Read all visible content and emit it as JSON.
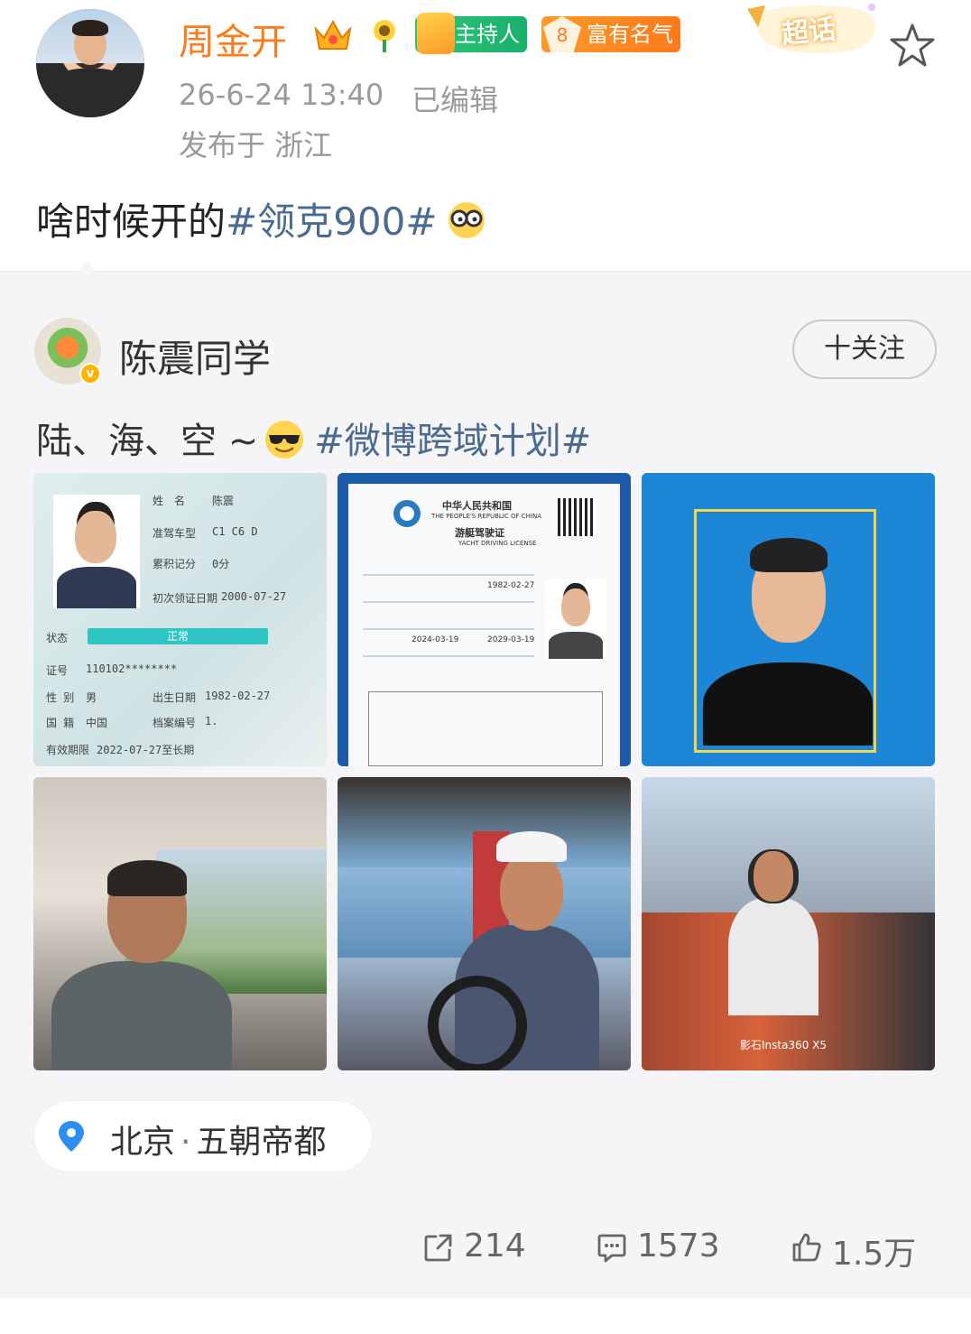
{
  "post": {
    "author": "周金开",
    "badges": {
      "host": "主持人",
      "fame_level": "8",
      "fame": "富有名气",
      "super_topic": "超话"
    },
    "time": "26-6-24 13:40",
    "edited": "已编辑",
    "location": "发布于 浙江",
    "text_prefix": "啥时候开的",
    "hashtag": "#领克900#"
  },
  "repost": {
    "author": "陈震同学",
    "follow_label": "十关注",
    "text_prefix": "陆、海、空 ~",
    "hashtag": "#微博跨域计划#",
    "photos": {
      "p1": {
        "name_label": "姓　名",
        "name_value": "陈震",
        "class_label": "准驾车型",
        "class_value": "C1 C6 D",
        "points_label": "累积记分",
        "points_value": "0分",
        "first_issue_label": "初次领证日期",
        "first_issue_value": "2000-07-27",
        "status_label": "状态",
        "status_value": "正常",
        "id_label": "证号",
        "id_value": "110102********",
        "sex_label": "性 别",
        "sex_value": "男",
        "birth_label": "出生日期",
        "birth_value": "1982-02-27",
        "nation_label": "国 籍",
        "nation_value": "中国",
        "file_label": "档案编号",
        "file_value": "1.",
        "valid_label": "有效期限",
        "valid_value": "2022-07-27至长期"
      },
      "p2": {
        "title_cn": "中华人民共和国",
        "title_en": "THE PEOPLE'S REPUBLIC OF CHINA",
        "doc_cn": "游艇驾驶证",
        "doc_en": "YACHT DRIVING LICENSE",
        "birth": "1982-02-27",
        "expiry": "2029-03-19",
        "issue": "2024-03-19"
      },
      "p6": {
        "watermark": "影石Insta360 X5"
      }
    },
    "place": {
      "city": "北京",
      "separator": "·",
      "desc": "五朝帝都"
    }
  },
  "actions": {
    "reposts": "214",
    "comments": "1573",
    "likes": "1.5万"
  },
  "colors": {
    "author_orange": "#ff7a1a",
    "hashtag_blue": "#4a6a90",
    "meta_gray": "#9a9a9a",
    "pin_blue": "#2b8ef0"
  },
  "icons": [
    "crown-badge-icon",
    "sunflower-badge-icon",
    "host-badge-icon",
    "fame-badge-icon",
    "star-icon",
    "glasses-emoji-icon",
    "cool-emoji-icon",
    "location-pin-icon",
    "repost-icon",
    "comment-icon",
    "like-icon"
  ]
}
